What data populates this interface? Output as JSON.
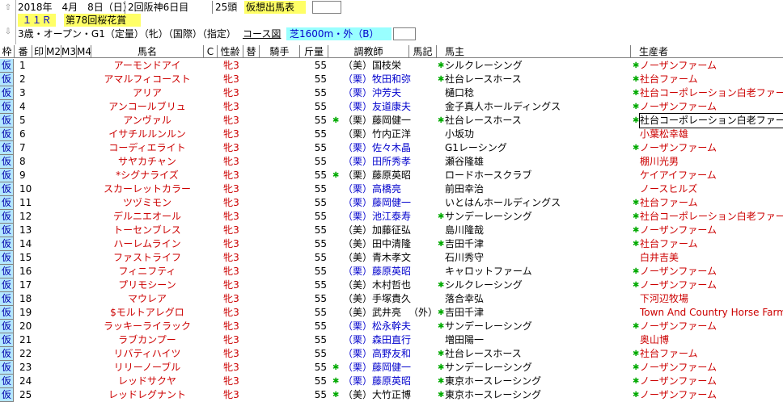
{
  "header": {
    "date": "2018年　4月　8日（日）",
    "meeting": "2回阪神6日目",
    "runners": "25頭",
    "card_type": "仮想出馬表",
    "race_no": "１１Ｒ",
    "race_name": "第78回桜花賞",
    "conditions": "3歳・オープン・G1（定量）（牝）（国際）（指定）",
    "course_label": "コース図",
    "course": "芝1600m・外（B）"
  },
  "columns": [
    "枠",
    "番",
    "印",
    "M2",
    "M3",
    "M4",
    "馬名",
    "C",
    "性齢",
    "替",
    "騎手",
    "斤量",
    "調教師",
    "馬記",
    "馬主",
    "生産者"
  ],
  "frame_label": "仮",
  "outside_label": "（外）",
  "horses": [
    {
      "no": "1",
      "name": "アーモンドアイ",
      "sex": "牝3",
      "wt": "55",
      "trainer": "（美）国枝栄",
      "trainer_blue": false,
      "trainer_mark": false,
      "owner": "シルクレーシング",
      "owner_mark": true,
      "breeder": "ノーザンファーム",
      "breeder_mark": true,
      "breeder_red": true
    },
    {
      "no": "2",
      "name": "アマルフィコースト",
      "sex": "牝3",
      "wt": "55",
      "trainer": "（栗）牧田和弥",
      "trainer_blue": true,
      "trainer_mark": false,
      "owner": "社台レースホース",
      "owner_mark": true,
      "breeder": "社台ファーム",
      "breeder_mark": true,
      "breeder_red": true
    },
    {
      "no": "3",
      "name": "アリア",
      "sex": "牝3",
      "wt": "55",
      "trainer": "（栗）沖芳夫",
      "trainer_blue": true,
      "trainer_mark": false,
      "owner": "樋口稔",
      "owner_mark": false,
      "breeder": "社台コーポレーション白老ファーム",
      "breeder_mark": true,
      "breeder_red": true
    },
    {
      "no": "4",
      "name": "アンコールブリュ",
      "sex": "牝3",
      "wt": "55",
      "trainer": "（栗）友道康夫",
      "trainer_blue": true,
      "trainer_mark": false,
      "owner": "金子真人ホールディングス",
      "owner_mark": false,
      "breeder": "ノーザンファーム",
      "breeder_mark": true,
      "breeder_red": true
    },
    {
      "no": "5",
      "name": "アンヴァル",
      "sex": "牝3",
      "wt": "55",
      "trainer": "（栗）藤岡健一",
      "trainer_blue": false,
      "trainer_mark": true,
      "owner": "社台レースホース",
      "owner_mark": true,
      "breeder": "社台コーポレーション白老ファーム",
      "breeder_mark": true,
      "breeder_red": false,
      "breeder_outlined": true
    },
    {
      "no": "6",
      "name": "イサチルルンルン",
      "sex": "牝3",
      "wt": "55",
      "trainer": "（栗）竹内正洋",
      "trainer_blue": false,
      "trainer_mark": false,
      "owner": "小坂功",
      "owner_mark": false,
      "breeder": "小葉松幸雄",
      "breeder_mark": false,
      "breeder_red": true
    },
    {
      "no": "7",
      "name": "コーディエライト",
      "sex": "牝3",
      "wt": "55",
      "trainer": "（栗）佐々木晶",
      "trainer_blue": true,
      "trainer_mark": false,
      "owner": "G1レーシング",
      "owner_mark": false,
      "breeder": "ノーザンファーム",
      "breeder_mark": true,
      "breeder_red": true
    },
    {
      "no": "8",
      "name": "サヤカチャン",
      "sex": "牝3",
      "wt": "55",
      "trainer": "（栗）田所秀孝",
      "trainer_blue": true,
      "trainer_mark": false,
      "owner": "瀬谷隆雄",
      "owner_mark": false,
      "breeder": "棚川光男",
      "breeder_mark": false,
      "breeder_red": true
    },
    {
      "no": "9",
      "name": "*シグナライズ",
      "sex": "牝3",
      "wt": "55",
      "trainer": "（栗）藤原英昭",
      "trainer_blue": false,
      "trainer_mark": true,
      "owner": "ロードホースクラブ",
      "owner_mark": false,
      "breeder": "ケイアイファーム",
      "breeder_mark": false,
      "breeder_red": true
    },
    {
      "no": "10",
      "name": "スカーレットカラー",
      "sex": "牝3",
      "wt": "55",
      "trainer": "（栗）高橋亮",
      "trainer_blue": true,
      "trainer_mark": false,
      "owner": "前田幸治",
      "owner_mark": false,
      "breeder": "ノースヒルズ",
      "breeder_mark": false,
      "breeder_red": true
    },
    {
      "no": "11",
      "name": "ツヅミモン",
      "sex": "牝3",
      "wt": "55",
      "trainer": "（栗）藤岡健一",
      "trainer_blue": true,
      "trainer_mark": false,
      "owner": "いとはんホールディングス",
      "owner_mark": false,
      "breeder": "社台ファーム",
      "breeder_mark": true,
      "breeder_red": true
    },
    {
      "no": "12",
      "name": "デルニエオール",
      "sex": "牝3",
      "wt": "55",
      "trainer": "（栗）池江泰寿",
      "trainer_blue": true,
      "trainer_mark": false,
      "owner": "サンデーレーシング",
      "owner_mark": true,
      "breeder": "社台コーポレーション白老ファーム",
      "breeder_mark": true,
      "breeder_red": true
    },
    {
      "no": "13",
      "name": "トーセンブレス",
      "sex": "牝3",
      "wt": "55",
      "trainer": "（美）加藤征弘",
      "trainer_blue": false,
      "trainer_mark": false,
      "owner": "島川隆哉",
      "owner_mark": false,
      "breeder": "ノーザンファーム",
      "breeder_mark": true,
      "breeder_red": true
    },
    {
      "no": "14",
      "name": "ハーレムライン",
      "sex": "牝3",
      "wt": "55",
      "trainer": "（美）田中清隆",
      "trainer_blue": false,
      "trainer_mark": false,
      "owner": "吉田千津",
      "owner_mark": true,
      "breeder": "社台ファーム",
      "breeder_mark": true,
      "breeder_red": true
    },
    {
      "no": "15",
      "name": "ファストライフ",
      "sex": "牝3",
      "wt": "55",
      "trainer": "（美）青木孝文",
      "trainer_blue": false,
      "trainer_mark": false,
      "owner": "石川秀守",
      "owner_mark": false,
      "breeder": "白井吉美",
      "breeder_mark": false,
      "breeder_red": true
    },
    {
      "no": "16",
      "name": "フィニフティ",
      "sex": "牝3",
      "wt": "55",
      "trainer": "（栗）藤原英昭",
      "trainer_blue": true,
      "trainer_mark": false,
      "owner": "キャロットファーム",
      "owner_mark": false,
      "breeder": "ノーザンファーム",
      "breeder_mark": true,
      "breeder_red": true
    },
    {
      "no": "17",
      "name": "プリモシーン",
      "sex": "牝3",
      "wt": "55",
      "trainer": "（美）木村哲也",
      "trainer_blue": false,
      "trainer_mark": false,
      "owner": "シルクレーシング",
      "owner_mark": true,
      "breeder": "ノーザンファーム",
      "breeder_mark": true,
      "breeder_red": true
    },
    {
      "no": "18",
      "name": "マウレア",
      "sex": "牝3",
      "wt": "55",
      "trainer": "（美）手塚貴久",
      "trainer_blue": false,
      "trainer_mark": false,
      "owner": "落合幸弘",
      "owner_mark": false,
      "breeder": "下河辺牧場",
      "breeder_mark": false,
      "breeder_red": true
    },
    {
      "no": "19",
      "name": "$モルトアレグロ",
      "sex": "牝3",
      "wt": "55",
      "trainer": "（美）武井亮",
      "trainer_blue": false,
      "trainer_mark": false,
      "outside": true,
      "owner": "吉田千津",
      "owner_mark": true,
      "breeder": "Town And Country Horse Farms",
      "breeder_mark": false,
      "breeder_red": true
    },
    {
      "no": "20",
      "name": "ラッキーライラック",
      "sex": "牝3",
      "wt": "55",
      "trainer": "（栗）松永幹夫",
      "trainer_blue": true,
      "trainer_mark": false,
      "owner": "サンデーレーシング",
      "owner_mark": true,
      "breeder": "ノーザンファーム",
      "breeder_mark": true,
      "breeder_red": true
    },
    {
      "no": "21",
      "name": "ラブカンプー",
      "sex": "牝3",
      "wt": "55",
      "trainer": "（栗）森田直行",
      "trainer_blue": true,
      "trainer_mark": false,
      "owner": "増田陽一",
      "owner_mark": false,
      "breeder": "奥山博",
      "breeder_mark": false,
      "breeder_red": true
    },
    {
      "no": "22",
      "name": "リバティハイツ",
      "sex": "牝3",
      "wt": "55",
      "trainer": "（栗）高野友和",
      "trainer_blue": true,
      "trainer_mark": false,
      "owner": "社台レースホース",
      "owner_mark": true,
      "breeder": "社台ファーム",
      "breeder_mark": true,
      "breeder_red": true
    },
    {
      "no": "23",
      "name": "リリーノーブル",
      "sex": "牝3",
      "wt": "55",
      "trainer": "（栗）藤岡健一",
      "trainer_blue": true,
      "trainer_mark": true,
      "owner": "サンデーレーシング",
      "owner_mark": true,
      "breeder": "ノーザンファーム",
      "breeder_mark": true,
      "breeder_red": true
    },
    {
      "no": "24",
      "name": "レッドサクヤ",
      "sex": "牝3",
      "wt": "55",
      "trainer": "（栗）藤原英昭",
      "trainer_blue": true,
      "trainer_mark": true,
      "owner": "東京ホースレーシング",
      "owner_mark": true,
      "breeder": "ノーザンファーム",
      "breeder_mark": true,
      "breeder_red": true
    },
    {
      "no": "25",
      "name": "レッドレグナント",
      "sex": "牝3",
      "wt": "55",
      "trainer": "（美）大竹正博",
      "trainer_blue": false,
      "trainer_mark": true,
      "owner": "東京ホースレーシング",
      "owner_mark": true,
      "breeder": "ノーザンファーム",
      "breeder_mark": true,
      "breeder_red": true
    }
  ]
}
